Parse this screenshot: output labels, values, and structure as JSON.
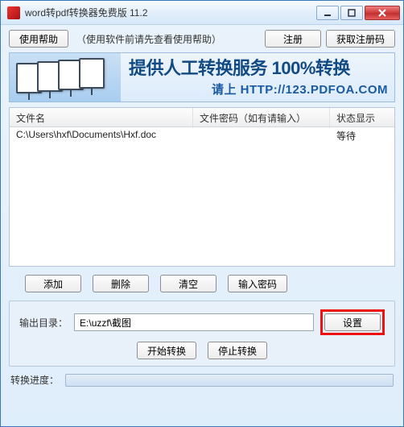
{
  "title": "word转pdf转换器免费版 11.2",
  "toolbar": {
    "help": "使用帮助",
    "hint": "（使用软件前请先查看使用帮助）",
    "register": "注册",
    "get_code": "获取注册码"
  },
  "banner": {
    "headline": "提供人工转换服务 100%转换",
    "subline": "请上 HTTP://123.PDFOA.COM"
  },
  "list": {
    "headers": {
      "file": "文件名",
      "password": "文件密码（如有请输入）",
      "status": "状态显示"
    },
    "rows": [
      {
        "file": "C:\\Users\\hxf\\Documents\\Hxf.doc",
        "password": "",
        "status": "等待"
      }
    ]
  },
  "mid_buttons": {
    "add": "添加",
    "delete": "删除",
    "clear": "清空",
    "input_pwd": "输入密码"
  },
  "output": {
    "label": "输出目录：",
    "path": "E:\\uzzf\\截图",
    "set": "设置",
    "start": "开始转换",
    "stop": "停止转换"
  },
  "progress": {
    "label": "转换进度："
  }
}
